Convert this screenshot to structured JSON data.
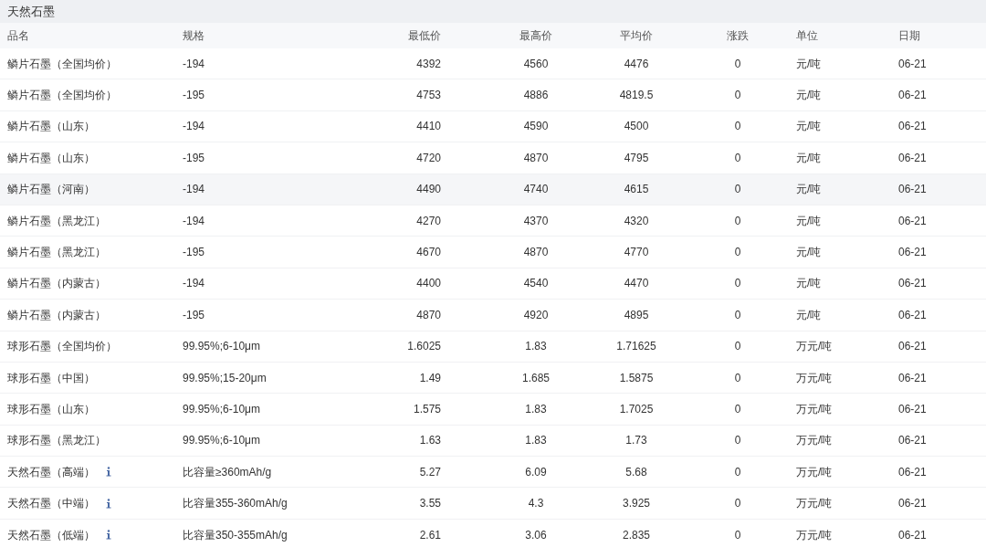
{
  "title": "天然石墨",
  "columns": [
    "品名",
    "规格",
    "最低价",
    "最高价",
    "平均价",
    "涨跌",
    "单位",
    "日期"
  ],
  "rows": [
    {
      "cells": [
        "鳞片石墨（全国均价）",
        "-194",
        "4392",
        "4560",
        "4476",
        "0",
        "元/吨",
        "06-21"
      ],
      "info": false,
      "highlighted": false
    },
    {
      "cells": [
        "鳞片石墨（全国均价）",
        "-195",
        "4753",
        "4886",
        "4819.5",
        "0",
        "元/吨",
        "06-21"
      ],
      "info": false,
      "highlighted": false
    },
    {
      "cells": [
        "鳞片石墨（山东）",
        "-194",
        "4410",
        "4590",
        "4500",
        "0",
        "元/吨",
        "06-21"
      ],
      "info": false,
      "highlighted": false
    },
    {
      "cells": [
        "鳞片石墨（山东）",
        "-195",
        "4720",
        "4870",
        "4795",
        "0",
        "元/吨",
        "06-21"
      ],
      "info": false,
      "highlighted": false
    },
    {
      "cells": [
        "鳞片石墨（河南）",
        "-194",
        "4490",
        "4740",
        "4615",
        "0",
        "元/吨",
        "06-21"
      ],
      "info": false,
      "highlighted": true
    },
    {
      "cells": [
        "鳞片石墨（黑龙江）",
        "-194",
        "4270",
        "4370",
        "4320",
        "0",
        "元/吨",
        "06-21"
      ],
      "info": false,
      "highlighted": false
    },
    {
      "cells": [
        "鳞片石墨（黑龙江）",
        "-195",
        "4670",
        "4870",
        "4770",
        "0",
        "元/吨",
        "06-21"
      ],
      "info": false,
      "highlighted": false
    },
    {
      "cells": [
        "鳞片石墨（内蒙古）",
        "-194",
        "4400",
        "4540",
        "4470",
        "0",
        "元/吨",
        "06-21"
      ],
      "info": false,
      "highlighted": false
    },
    {
      "cells": [
        "鳞片石墨（内蒙古）",
        "-195",
        "4870",
        "4920",
        "4895",
        "0",
        "元/吨",
        "06-21"
      ],
      "info": false,
      "highlighted": false
    },
    {
      "cells": [
        "球形石墨（全国均价）",
        "99.95%;6-10μm",
        "1.6025",
        "1.83",
        "1.71625",
        "0",
        "万元/吨",
        "06-21"
      ],
      "info": false,
      "highlighted": false
    },
    {
      "cells": [
        "球形石墨（中国）",
        "99.95%;15-20μm",
        "1.49",
        "1.685",
        "1.5875",
        "0",
        "万元/吨",
        "06-21"
      ],
      "info": false,
      "highlighted": false
    },
    {
      "cells": [
        "球形石墨（山东）",
        "99.95%;6-10μm",
        "1.575",
        "1.83",
        "1.7025",
        "0",
        "万元/吨",
        "06-21"
      ],
      "info": false,
      "highlighted": false
    },
    {
      "cells": [
        "球形石墨（黑龙江）",
        "99.95%;6-10μm",
        "1.63",
        "1.83",
        "1.73",
        "0",
        "万元/吨",
        "06-21"
      ],
      "info": false,
      "highlighted": false
    },
    {
      "cells": [
        "天然石墨（高端）",
        "比容量≥360mAh/g",
        "5.27",
        "6.09",
        "5.68",
        "0",
        "万元/吨",
        "06-21"
      ],
      "info": true,
      "highlighted": false
    },
    {
      "cells": [
        "天然石墨（中端）",
        "比容量355-360mAh/g",
        "3.55",
        "4.3",
        "3.925",
        "0",
        "万元/吨",
        "06-21"
      ],
      "info": true,
      "highlighted": false
    },
    {
      "cells": [
        "天然石墨（低端）",
        "比容量350-355mAh/g",
        "2.61",
        "3.06",
        "2.835",
        "0",
        "万元/吨",
        "06-21"
      ],
      "info": true,
      "highlighted": false
    }
  ]
}
